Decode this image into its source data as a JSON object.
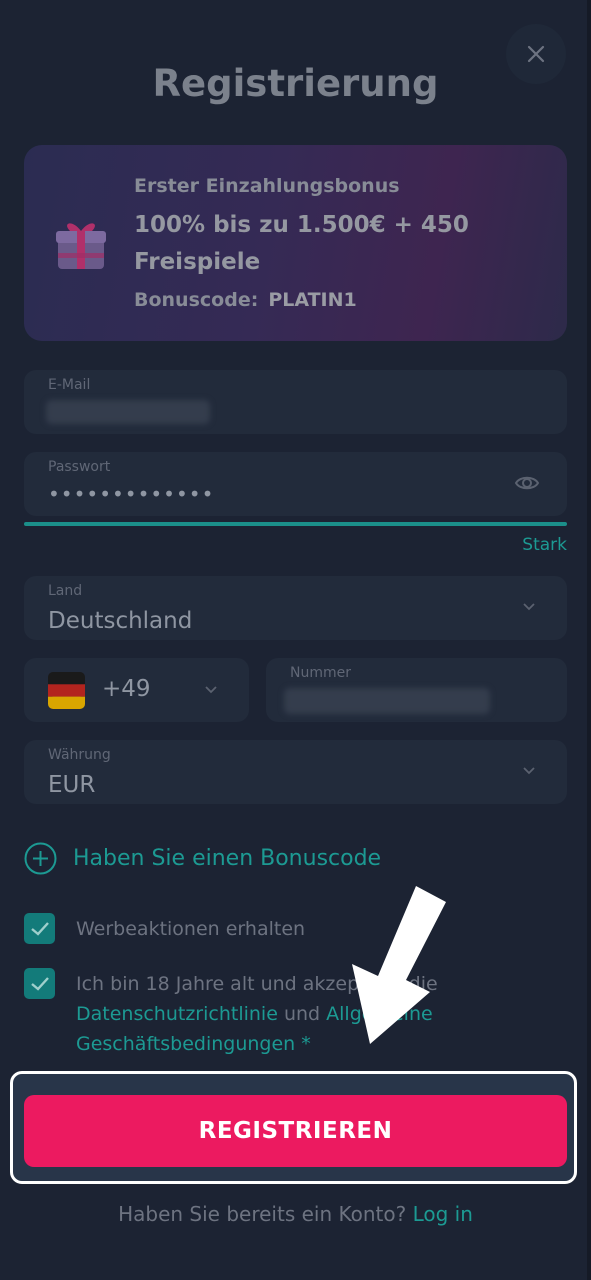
{
  "modal": {
    "title": "Registrierung",
    "close_icon": "close-icon"
  },
  "bonus": {
    "heading": "Erster Einzahlungsbonus",
    "offer": "100% bis zu 1.500€ + 450 Freispiele",
    "code_label": "Bonuscode:",
    "code_value": "PLATIN1",
    "icon": "gift-icon"
  },
  "form": {
    "email": {
      "label": "E-Mail",
      "value_blurred": true
    },
    "password": {
      "label": "Passwort",
      "value": "•••••••••••••",
      "icon": "eye-icon",
      "strength": "Stark",
      "strength_color": "#1c9a93"
    },
    "country": {
      "label": "Land",
      "value": "Deutschland"
    },
    "phone": {
      "prefix": "+49",
      "flag": "germany-flag-icon",
      "number_label": "Nummer",
      "number_blurred": true
    },
    "currency": {
      "label": "Währung",
      "value": "EUR"
    },
    "promo_link": "Haben Sie einen Bonuscode",
    "checkbox_promotions": {
      "label": "Werbeaktionen erhalten",
      "checked": true
    },
    "checkbox_terms": {
      "checked": true,
      "text_before": "Ich bin 18 Jahre alt und akzeptiere die",
      "privacy_link": "Datenschutzrichtlinie",
      "connector": "und",
      "terms_link": "Allgemeine Geschäftsbedingungen",
      "asterisk": "*"
    },
    "submit_label": "REGISTRIEREN"
  },
  "footer": {
    "question": "Haben Sie bereits ein Konto?",
    "login_link": "Log in"
  },
  "colors": {
    "accent": "#1c9a93",
    "primary_button": "#ec1a60",
    "background": "#1c2333"
  }
}
